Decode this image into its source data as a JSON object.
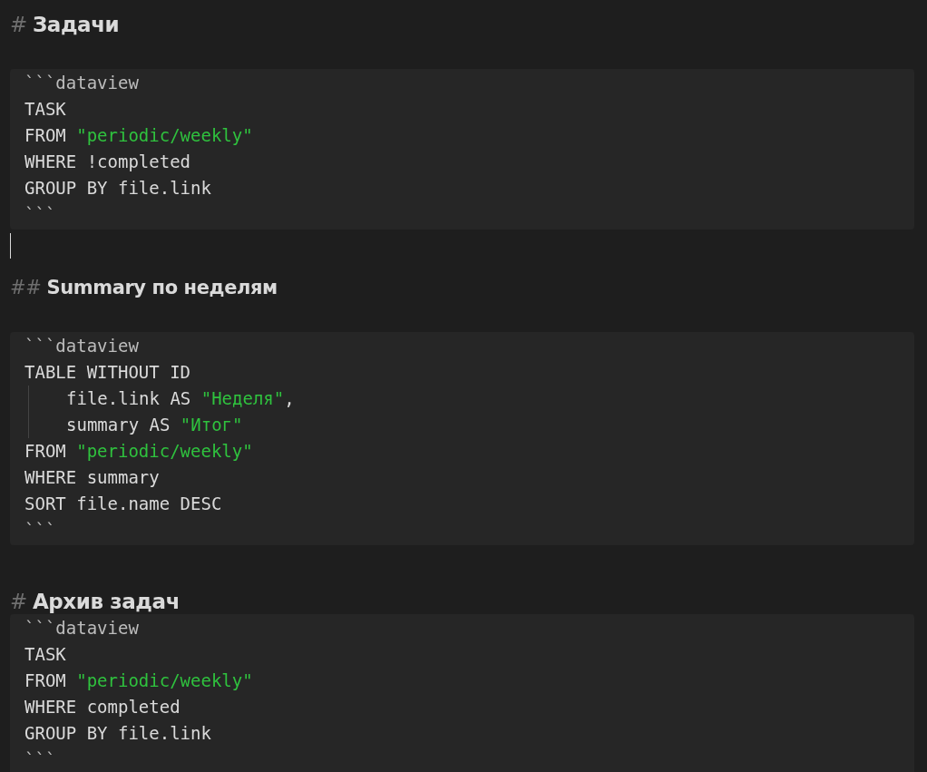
{
  "blocks": [
    {
      "kind": "heading1",
      "marker": "#",
      "text": "Задачи"
    },
    {
      "kind": "code",
      "lines": [
        {
          "indented": false,
          "segments": [
            {
              "kind": "fence",
              "text": "```dataview"
            }
          ]
        },
        {
          "indented": false,
          "segments": [
            {
              "kind": "plain",
              "text": "TASK"
            }
          ]
        },
        {
          "indented": false,
          "segments": [
            {
              "kind": "plain",
              "text": "FROM "
            },
            {
              "kind": "string",
              "text": "\"periodic/weekly\""
            }
          ]
        },
        {
          "indented": false,
          "segments": [
            {
              "kind": "plain",
              "text": "WHERE !completed"
            }
          ]
        },
        {
          "indented": false,
          "segments": [
            {
              "kind": "plain",
              "text": "GROUP BY file.link"
            }
          ]
        },
        {
          "indented": false,
          "segments": [
            {
              "kind": "fence",
              "text": "```"
            }
          ]
        }
      ]
    },
    {
      "kind": "empty",
      "cursor": true
    },
    {
      "kind": "heading2",
      "marker": "##",
      "text": "Summary по неделям"
    },
    {
      "kind": "code",
      "lines": [
        {
          "indented": false,
          "segments": [
            {
              "kind": "fence",
              "text": "```dataview"
            }
          ]
        },
        {
          "indented": false,
          "segments": [
            {
              "kind": "plain",
              "text": "TABLE WITHOUT ID"
            }
          ]
        },
        {
          "indented": true,
          "segments": [
            {
              "kind": "plain",
              "text": "file.link AS "
            },
            {
              "kind": "string",
              "text": "\"Неделя\""
            },
            {
              "kind": "plain",
              "text": ","
            }
          ]
        },
        {
          "indented": true,
          "segments": [
            {
              "kind": "plain",
              "text": "summary AS "
            },
            {
              "kind": "string",
              "text": "\"Итог\""
            }
          ]
        },
        {
          "indented": false,
          "segments": [
            {
              "kind": "plain",
              "text": "FROM "
            },
            {
              "kind": "string",
              "text": "\"periodic/weekly\""
            }
          ]
        },
        {
          "indented": false,
          "segments": [
            {
              "kind": "plain",
              "text": "WHERE summary"
            }
          ]
        },
        {
          "indented": false,
          "segments": [
            {
              "kind": "plain",
              "text": "SORT file.name DESC"
            }
          ]
        },
        {
          "indented": false,
          "segments": [
            {
              "kind": "fence",
              "text": "```"
            }
          ]
        }
      ]
    },
    {
      "kind": "heading1",
      "marker": "#",
      "text": "Архив задач"
    },
    {
      "kind": "code",
      "lines": [
        {
          "indented": false,
          "segments": [
            {
              "kind": "fence",
              "text": "```dataview"
            }
          ]
        },
        {
          "indented": false,
          "segments": [
            {
              "kind": "plain",
              "text": "TASK"
            }
          ]
        },
        {
          "indented": false,
          "segments": [
            {
              "kind": "plain",
              "text": "FROM "
            },
            {
              "kind": "string",
              "text": "\"periodic/weekly\""
            }
          ]
        },
        {
          "indented": false,
          "segments": [
            {
              "kind": "plain",
              "text": "WHERE completed"
            }
          ]
        },
        {
          "indented": false,
          "segments": [
            {
              "kind": "plain",
              "text": "GROUP BY file.link"
            }
          ]
        },
        {
          "indented": false,
          "segments": [
            {
              "kind": "fence",
              "text": "```"
            }
          ]
        }
      ]
    }
  ]
}
